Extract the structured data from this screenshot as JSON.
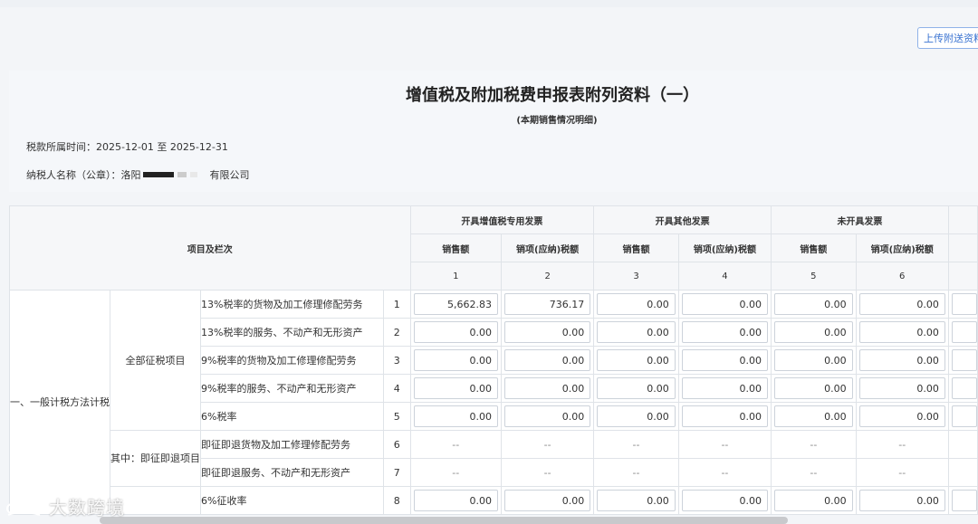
{
  "toolbar": {
    "upload_label": "上传附送资料"
  },
  "form": {
    "title": "增值税及附加税费申报表附列资料（一）",
    "subtitle": "(本期销售情况明细)",
    "period": "税款所属时间：2025-12-01 至 2025-12-31",
    "payer_prefix": "纳税人名称（公章）：洛阳",
    "payer_suffix": "有限公司"
  },
  "table": {
    "item_header": "项目及栏次",
    "groups": [
      "开具增值税专用发票",
      "开具其他发票",
      "未开具发票"
    ],
    "sub_headers": [
      "销售额",
      "销项(应纳)税额",
      "销售额",
      "销项(应纳)税额",
      "销售额",
      "销项(应纳)税额"
    ],
    "col_numbers": [
      "1",
      "2",
      "3",
      "4",
      "5",
      "6"
    ],
    "section_label": "一、一般计税方法计税",
    "group_full": "全部征税项目",
    "group_immediate": "其中：即征即退项目",
    "rows": [
      {
        "item": "13%税率的货物及加工修理修配劳务",
        "no": "1",
        "values": [
          "5,662.83",
          "736.17",
          "0.00",
          "0.00",
          "0.00",
          "0.00"
        ]
      },
      {
        "item": "13%税率的服务、不动产和无形资产",
        "no": "2",
        "values": [
          "0.00",
          "0.00",
          "0.00",
          "0.00",
          "0.00",
          "0.00"
        ]
      },
      {
        "item": "9%税率的货物及加工修理修配劳务",
        "no": "3",
        "values": [
          "0.00",
          "0.00",
          "0.00",
          "0.00",
          "0.00",
          "0.00"
        ]
      },
      {
        "item": "9%税率的服务、不动产和无形资产",
        "no": "4",
        "values": [
          "0.00",
          "0.00",
          "0.00",
          "0.00",
          "0.00",
          "0.00"
        ]
      },
      {
        "item": "6%税率",
        "no": "5",
        "values": [
          "0.00",
          "0.00",
          "0.00",
          "0.00",
          "0.00",
          "0.00"
        ]
      },
      {
        "item": "即征即退货物及加工修理修配劳务",
        "no": "6",
        "values": [
          "--",
          "--",
          "--",
          "--",
          "--",
          "--"
        ]
      },
      {
        "item": "即征即退服务、不动产和无形资产",
        "no": "7",
        "values": [
          "--",
          "--",
          "--",
          "--",
          "--",
          "--"
        ]
      },
      {
        "item": "6%征收率",
        "no": "8",
        "values": [
          "0.00",
          "0.00",
          "0.00",
          "0.00",
          "0.00",
          "0.00"
        ]
      }
    ]
  },
  "watermark": {
    "text": "大数跨境"
  }
}
